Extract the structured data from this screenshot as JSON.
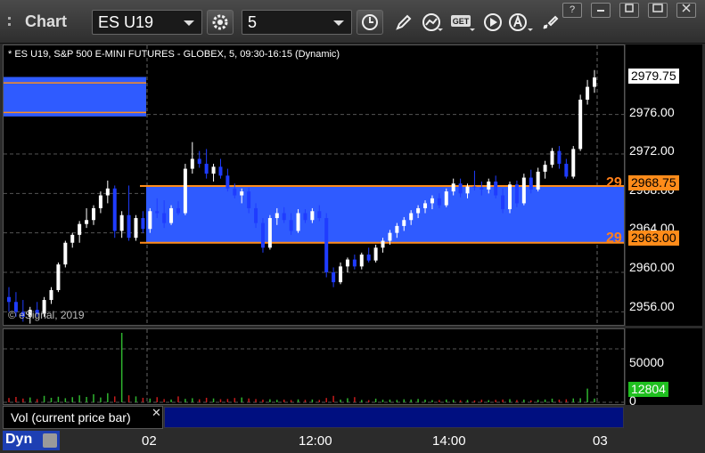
{
  "window": {
    "title": "Chart",
    "symbol": "ES U19",
    "interval": "5"
  },
  "chart": {
    "title": "* ES U19, S&P 500 E-MINI FUTURES - GLOBEX, 5, 09:30-16:15 (Dynamic)",
    "copyright": "© eSignal, 2019",
    "price_axis": [
      "2976.00",
      "2972.00",
      "2968.00",
      "2964.00",
      "2960.00",
      "2956.00"
    ],
    "last_price": "2979.75",
    "level_high": "2968.75",
    "level_low": "2963.00",
    "level_left_tag": "29",
    "volume_axis": [
      "50000",
      "0"
    ],
    "volume_last": "12804",
    "volume_label": "Vol (current price bar)",
    "time_labels": [
      "02",
      "12:00",
      "14:00",
      "03"
    ],
    "mode": "Dyn",
    "colors": {
      "up": "#ffffff",
      "down": "#1f3cff",
      "zone": "#2f5bff",
      "level": "#ff8c1a",
      "vol_up": "#2fb52f",
      "vol_down": "#c81c1c"
    }
  },
  "chart_data": {
    "type": "candlestick",
    "ylim": [
      2954.5,
      2983.0
    ],
    "levels": [
      2968.75,
      2963.0
    ],
    "candles": [
      [
        2957.5,
        2958.5,
        2956.0,
        2957.0
      ],
      [
        2957.0,
        2958.0,
        2955.5,
        2956.0
      ],
      [
        2956.0,
        2957.2,
        2955.0,
        2955.5
      ],
      [
        2955.5,
        2956.5,
        2954.8,
        2956.2
      ],
      [
        2956.2,
        2957.0,
        2955.5,
        2955.8
      ],
      [
        2955.8,
        2957.5,
        2955.5,
        2957.2
      ],
      [
        2957.2,
        2958.5,
        2956.8,
        2958.2
      ],
      [
        2958.2,
        2961.0,
        2958.0,
        2960.8
      ],
      [
        2960.8,
        2963.2,
        2960.5,
        2963.0
      ],
      [
        2963.0,
        2964.0,
        2962.5,
        2963.8
      ],
      [
        2963.8,
        2965.2,
        2963.0,
        2964.9
      ],
      [
        2964.9,
        2966.5,
        2964.5,
        2965.3
      ],
      [
        2965.3,
        2966.8,
        2964.8,
        2966.5
      ],
      [
        2966.5,
        2968.2,
        2966.0,
        2967.8
      ],
      [
        2967.8,
        2969.3,
        2967.0,
        2968.5
      ],
      [
        2968.5,
        2968.8,
        2963.5,
        2964.2
      ],
      [
        2964.2,
        2966.2,
        2963.5,
        2965.8
      ],
      [
        2965.8,
        2968.8,
        2963.2,
        2963.5
      ],
      [
        2963.5,
        2965.8,
        2963.2,
        2965.5
      ],
      [
        2965.5,
        2966.2,
        2964.0,
        2964.4
      ],
      [
        2964.4,
        2966.5,
        2964.0,
        2966.2
      ],
      [
        2966.2,
        2967.5,
        2965.5,
        2966.0
      ],
      [
        2966.0,
        2967.3,
        2964.5,
        2965.0
      ],
      [
        2965.0,
        2966.8,
        2964.8,
        2966.5
      ],
      [
        2966.5,
        2967.2,
        2965.8,
        2966.0
      ],
      [
        2966.0,
        2971.0,
        2965.8,
        2970.5
      ],
      [
        2970.5,
        2973.2,
        2970.0,
        2971.5
      ],
      [
        2971.5,
        2972.3,
        2970.6,
        2971.0
      ],
      [
        2971.0,
        2972.5,
        2969.5,
        2970.0
      ],
      [
        2970.0,
        2971.0,
        2969.2,
        2970.7
      ],
      [
        2970.7,
        2971.5,
        2969.5,
        2969.8
      ],
      [
        2969.8,
        2970.5,
        2968.2,
        2968.5
      ],
      [
        2968.5,
        2969.0,
        2967.5,
        2967.8
      ],
      [
        2967.8,
        2968.5,
        2967.0,
        2968.2
      ],
      [
        2968.2,
        2968.6,
        2966.0,
        2966.5
      ],
      [
        2966.5,
        2967.0,
        2964.5,
        2965.0
      ],
      [
        2965.0,
        2965.5,
        2962.0,
        2962.5
      ],
      [
        2962.5,
        2965.8,
        2962.3,
        2965.5
      ],
      [
        2965.5,
        2966.5,
        2964.8,
        2966.0
      ],
      [
        2966.0,
        2966.6,
        2965.0,
        2965.3
      ],
      [
        2965.3,
        2966.0,
        2963.8,
        2964.2
      ],
      [
        2964.2,
        2966.4,
        2964.0,
        2966.0
      ],
      [
        2966.0,
        2966.4,
        2965.0,
        2965.3
      ],
      [
        2965.3,
        2966.5,
        2965.0,
        2966.2
      ],
      [
        2966.2,
        2966.8,
        2965.2,
        2965.5
      ],
      [
        2965.5,
        2966.0,
        2959.5,
        2960.0
      ],
      [
        2960.0,
        2960.5,
        2958.5,
        2959.0
      ],
      [
        2959.0,
        2961.0,
        2958.8,
        2960.6
      ],
      [
        2960.6,
        2961.5,
        2960.0,
        2961.3
      ],
      [
        2961.3,
        2961.8,
        2960.3,
        2960.6
      ],
      [
        2960.6,
        2962.0,
        2960.3,
        2961.8
      ],
      [
        2961.8,
        2962.5,
        2961.0,
        2961.2
      ],
      [
        2961.2,
        2962.8,
        2961.0,
        2962.5
      ],
      [
        2962.5,
        2963.5,
        2962.0,
        2963.2
      ],
      [
        2963.2,
        2964.3,
        2962.8,
        2964.0
      ],
      [
        2964.0,
        2965.0,
        2963.5,
        2964.7
      ],
      [
        2964.7,
        2965.6,
        2964.2,
        2965.3
      ],
      [
        2965.3,
        2966.3,
        2964.8,
        2966.0
      ],
      [
        2966.0,
        2966.8,
        2965.5,
        2966.5
      ],
      [
        2966.5,
        2967.3,
        2966.0,
        2967.0
      ],
      [
        2967.0,
        2967.8,
        2966.4,
        2967.5
      ],
      [
        2967.5,
        2968.0,
        2966.5,
        2966.8
      ],
      [
        2966.8,
        2968.5,
        2966.6,
        2968.2
      ],
      [
        2968.2,
        2969.5,
        2967.8,
        2969.0
      ],
      [
        2969.0,
        2969.5,
        2967.6,
        2968.0
      ],
      [
        2968.0,
        2969.0,
        2967.5,
        2968.7
      ],
      [
        2968.7,
        2970.3,
        2968.3,
        2968.6
      ],
      [
        2968.6,
        2969.2,
        2967.8,
        2968.4
      ],
      [
        2968.4,
        2969.5,
        2968.0,
        2969.2
      ],
      [
        2969.2,
        2969.8,
        2967.5,
        2967.8
      ],
      [
        2967.8,
        2968.5,
        2966.0,
        2966.4
      ],
      [
        2966.4,
        2969.2,
        2966.0,
        2968.9
      ],
      [
        2968.9,
        2969.3,
        2966.6,
        2967.0
      ],
      [
        2967.0,
        2970.0,
        2966.8,
        2969.6
      ],
      [
        2969.6,
        2970.4,
        2968.0,
        2968.4
      ],
      [
        2968.4,
        2970.6,
        2968.2,
        2970.2
      ],
      [
        2970.2,
        2971.3,
        2969.5,
        2970.9
      ],
      [
        2970.9,
        2972.6,
        2970.6,
        2972.3
      ],
      [
        2972.3,
        2972.8,
        2970.5,
        2971.0
      ],
      [
        2971.0,
        2971.5,
        2969.5,
        2969.7
      ],
      [
        2969.7,
        2972.8,
        2969.5,
        2972.5
      ],
      [
        2972.5,
        2978.0,
        2972.3,
        2977.5
      ],
      [
        2977.5,
        2979.5,
        2977.0,
        2978.8
      ],
      [
        2978.8,
        2980.5,
        2978.2,
        2979.75
      ]
    ],
    "volume_max": 65000,
    "volume": [
      4000,
      5000,
      3500,
      4500,
      3000,
      6000,
      4200,
      5200,
      3800,
      4800,
      6500,
      5000,
      7500,
      4500,
      8500,
      5500,
      9000,
      6500,
      5500,
      4200,
      3500,
      4800,
      3000,
      2600,
      5500,
      3200,
      3800,
      2800,
      4200,
      3600,
      2900,
      3100,
      4000,
      4500,
      3600,
      3000,
      2500,
      2800,
      2300,
      2500,
      2100,
      2700,
      2300,
      2600,
      2200,
      4000,
      6000,
      2500,
      3800,
      4800,
      2200,
      2000,
      3400,
      2400,
      2500,
      2200,
      2800,
      2600,
      3100,
      2500,
      2000,
      2100,
      2600,
      2300,
      1900,
      2200,
      1700,
      2400,
      2000,
      2300,
      2600,
      2900,
      2100,
      2500,
      1800,
      2300,
      2600,
      3400,
      2500,
      2800,
      3600,
      3800,
      12804,
      3500
    ],
    "volume_spike": {
      "index": 16,
      "value": 65000
    }
  }
}
